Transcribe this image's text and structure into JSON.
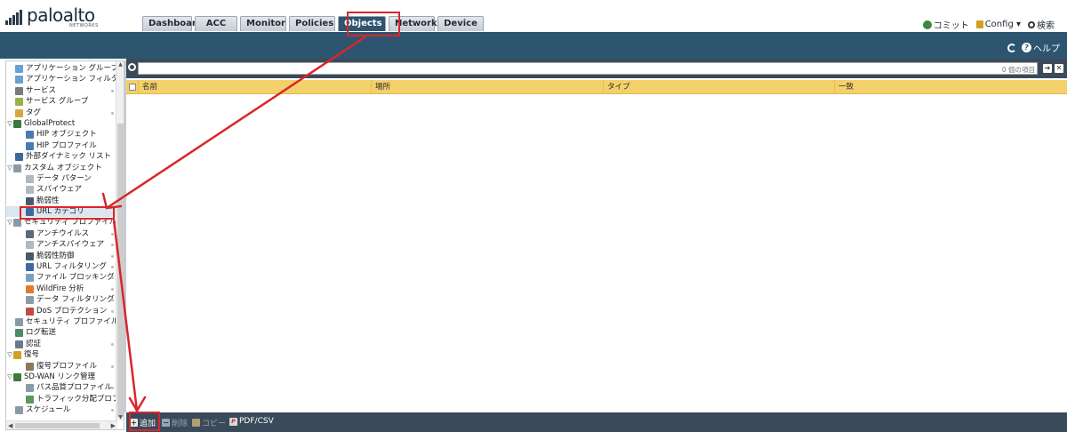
{
  "logo": {
    "wordmark": "paloalto",
    "sub": "NETWORKS"
  },
  "tabs": [
    {
      "label": "Dashboard",
      "active": false
    },
    {
      "label": "ACC",
      "active": false
    },
    {
      "label": "Monitor",
      "active": false
    },
    {
      "label": "Policies",
      "active": false
    },
    {
      "label": "Objects",
      "active": true
    },
    {
      "label": "Network",
      "active": false
    },
    {
      "label": "Device",
      "active": false
    }
  ],
  "topright": {
    "commit": "コミット",
    "config": "Config ▾",
    "search": "検索"
  },
  "band": {
    "help": "ヘルプ"
  },
  "tree": [
    {
      "label": "アプリケーション グループ",
      "level": 1,
      "icon": "#6aa0d4",
      "dot": false
    },
    {
      "label": "アプリケーション フィルタ",
      "level": 1,
      "icon": "#6aa0d4",
      "dot": false
    },
    {
      "label": "サービス",
      "level": 1,
      "icon": "#7a7a7a",
      "dot": true
    },
    {
      "label": "サービス グループ",
      "level": 1,
      "icon": "#9ab04a",
      "dot": false
    },
    {
      "label": "タグ",
      "level": 1,
      "icon": "#d8a840",
      "dot": true
    },
    {
      "label": "GlobalProtect",
      "level": 0,
      "icon": "#3a7a3a",
      "dot": false,
      "caret": "▽"
    },
    {
      "label": "HIP オブジェクト",
      "level": 2,
      "icon": "#4a7ab0",
      "dot": false
    },
    {
      "label": "HIP プロファイル",
      "level": 2,
      "icon": "#4a7ab0",
      "dot": false
    },
    {
      "label": "外部ダイナミック リスト",
      "level": 1,
      "icon": "#3a6a9a",
      "dot": false
    },
    {
      "label": "カスタム オブジェクト",
      "level": 0,
      "icon": "#8a9aa8",
      "dot": false,
      "caret": "▽"
    },
    {
      "label": "データ パターン",
      "level": 2,
      "icon": "#b0b8c0",
      "dot": false
    },
    {
      "label": "スパイウェア",
      "level": 2,
      "icon": "#b0b8c0",
      "dot": false
    },
    {
      "label": "脆弱性",
      "level": 2,
      "icon": "#4a5a6a",
      "dot": false
    },
    {
      "label": "URL カテゴリ",
      "level": 2,
      "icon": "#3a6aa0",
      "dot": false,
      "selected": true
    },
    {
      "label": "セキュリティ プロファイル",
      "level": 0,
      "icon": "#8a9aa8",
      "dot": false,
      "caret": "▽"
    },
    {
      "label": "アンチウイルス",
      "level": 2,
      "icon": "#5a6a7a",
      "dot": true
    },
    {
      "label": "アンチスパイウェア",
      "level": 2,
      "icon": "#b0b8c0",
      "dot": true
    },
    {
      "label": "脆弱性防御",
      "level": 2,
      "icon": "#4a5a6a",
      "dot": true
    },
    {
      "label": "URL フィルタリング",
      "level": 2,
      "icon": "#3a6aa0",
      "dot": true
    },
    {
      "label": "ファイル ブロッキング",
      "level": 2,
      "icon": "#7aa0c0",
      "dot": true
    },
    {
      "label": "WildFire 分析",
      "level": 2,
      "icon": "#e07a30",
      "dot": true
    },
    {
      "label": "データ フィルタリング",
      "level": 2,
      "icon": "#8a9aa8",
      "dot": true
    },
    {
      "label": "DoS プロテクション",
      "level": 2,
      "icon": "#c04a4a",
      "dot": true
    },
    {
      "label": "セキュリティ プロファイル グループ",
      "level": 1,
      "icon": "#8a9aa8",
      "dot": false
    },
    {
      "label": "ログ転送",
      "level": 1,
      "icon": "#4a8a6a",
      "dot": false
    },
    {
      "label": "認証",
      "level": 1,
      "icon": "#6a7a8a",
      "dot": true
    },
    {
      "label": "復号",
      "level": 0,
      "icon": "#d4a020",
      "dot": false,
      "caret": "▽"
    },
    {
      "label": "復号プロファイル",
      "level": 2,
      "icon": "#8a7a5a",
      "dot": true
    },
    {
      "label": "SD-WAN リンク管理",
      "level": 0,
      "icon": "#3a7a3a",
      "dot": false,
      "caret": "▽"
    },
    {
      "label": "パス品質プロファイル",
      "level": 2,
      "icon": "#8a9aa8",
      "dot": true
    },
    {
      "label": "トラフィック分配プロファイル",
      "level": 2,
      "icon": "#5a9a5a",
      "dot": false
    },
    {
      "label": "スケジュール",
      "level": 1,
      "icon": "#8a9aa8",
      "dot": true
    }
  ],
  "search": {
    "placeholder": "",
    "count": "0 個の項目"
  },
  "table": {
    "columns": [
      "名前",
      "場所",
      "タイプ",
      "一致"
    ]
  },
  "toolbar": {
    "add": "追加",
    "delete": "削除",
    "copy": "コピー",
    "pdf": "PDF/CSV"
  }
}
